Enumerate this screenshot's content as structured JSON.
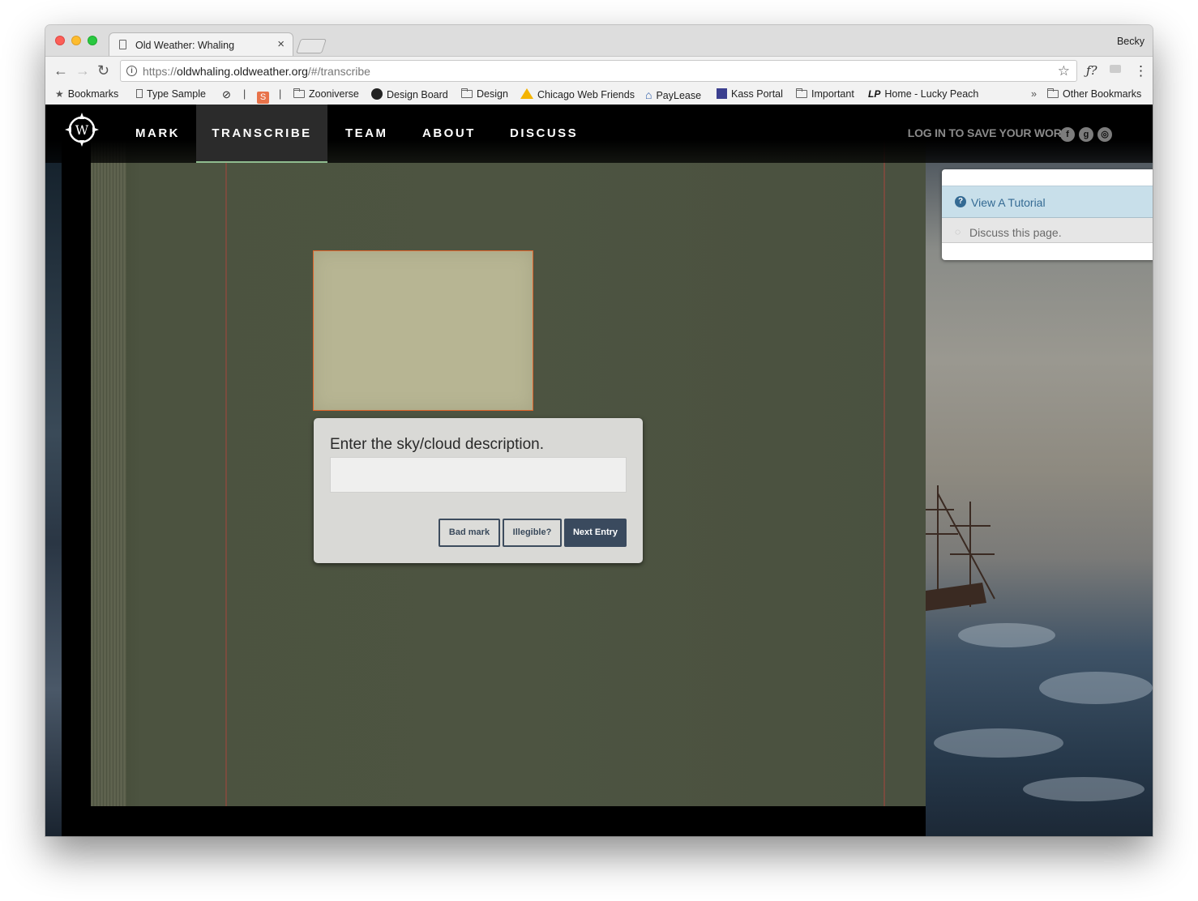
{
  "browser": {
    "tab_title": "Old Weather: Whaling",
    "tab_close": "×",
    "profile_name": "Becky",
    "url_prefix": "https://",
    "url_host": "oldwhaling.oldweather.org",
    "url_path": "/#/transcribe",
    "nav": {
      "back": "←",
      "forward": "→",
      "reload": "↻",
      "menu": "⋮",
      "ext_fq": "ƒ?"
    },
    "bookmarks_overflow": "»",
    "bookmarks": [
      {
        "label": "Bookmarks",
        "icon": "star-icon"
      },
      {
        "label": "Type Sample",
        "icon": "page-icon"
      },
      {
        "label": "",
        "icon": "circle-slash-icon"
      },
      {
        "label": "|",
        "icon": ""
      },
      {
        "label": "",
        "icon": "orange-s-icon"
      },
      {
        "label": "|",
        "icon": ""
      },
      {
        "label": "Zooniverse",
        "icon": "folder-icon"
      },
      {
        "label": "Design Board",
        "icon": "github-icon"
      },
      {
        "label": "Design",
        "icon": "folder-icon"
      },
      {
        "label": "Chicago Web Friends",
        "icon": "google-drive-icon"
      },
      {
        "label": "PayLease",
        "icon": "paylease-icon"
      },
      {
        "label": "Kass Portal",
        "icon": "building-icon"
      },
      {
        "label": "Important",
        "icon": "folder-icon"
      },
      {
        "label": "Home - Lucky Peach",
        "icon": "lp-icon"
      },
      {
        "label": "Other Bookmarks",
        "icon": "folder-icon"
      }
    ]
  },
  "site": {
    "logo_letter": "W",
    "nav": [
      {
        "label": "MARK",
        "active": false
      },
      {
        "label": "TRANSCRIBE",
        "active": true
      },
      {
        "label": "TEAM",
        "active": false
      },
      {
        "label": "ABOUT",
        "active": false
      },
      {
        "label": "DISCUSS",
        "active": false
      }
    ],
    "login_text": "LOG IN TO SAVE YOUR WORK:",
    "social": [
      {
        "icon": "facebook-icon",
        "glyph": "f"
      },
      {
        "icon": "google-icon",
        "glyph": "g"
      },
      {
        "icon": "zooniverse-icon",
        "glyph": "◎"
      }
    ]
  },
  "side_panel": {
    "tutorial_label": "View A Tutorial",
    "tutorial_glyph": "?",
    "discuss_label": "Discuss this page.",
    "discuss_glyph": "💬"
  },
  "dialog": {
    "prompt": "Enter the sky/cloud description.",
    "input_value": "",
    "buttons": {
      "bad_mark": "Bad mark",
      "illegible": "Illegible?",
      "next": "Next Entry"
    }
  },
  "colors": {
    "mark_border": "#e0642a",
    "nav_active_underline": "#8fbc8f",
    "tutorial_text": "#346a93",
    "next_button": "#3a4a5e"
  }
}
